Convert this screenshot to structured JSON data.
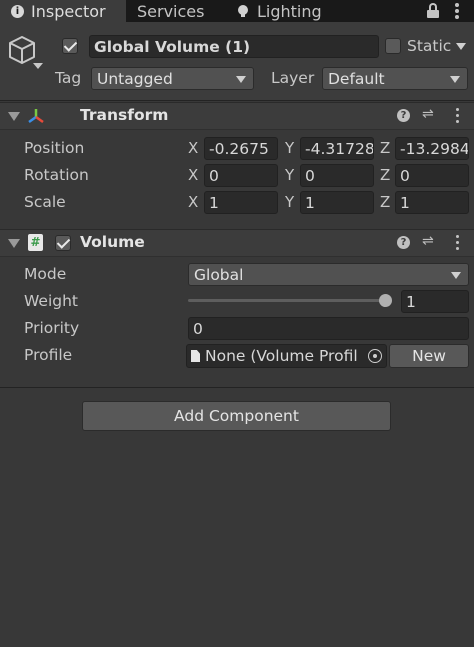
{
  "tabs": [
    {
      "label": "Inspector",
      "icon": "info-icon",
      "active": true
    },
    {
      "label": "Services",
      "active": false
    },
    {
      "label": "Lighting",
      "icon": "bulb-icon",
      "active": false
    }
  ],
  "gameobject": {
    "active": true,
    "name": "Global Volume (1)",
    "static_label": "Static",
    "static_checked": false,
    "tag_label": "Tag",
    "tag_value": "Untagged",
    "layer_label": "Layer",
    "layer_value": "Default"
  },
  "transform": {
    "title": "Transform",
    "rows": [
      {
        "label": "Position",
        "x": "-0.2675",
        "y": "-4.31728",
        "z": "-13.2984"
      },
      {
        "label": "Rotation",
        "x": "0",
        "y": "0",
        "z": "0"
      },
      {
        "label": "Scale",
        "x": "1",
        "y": "1",
        "z": "1"
      }
    ],
    "axes": [
      "X",
      "Y",
      "Z"
    ]
  },
  "volume": {
    "title": "Volume",
    "enabled": true,
    "mode_label": "Mode",
    "mode_value": "Global",
    "weight_label": "Weight",
    "weight_value": "1",
    "weight_fraction": 1.0,
    "priority_label": "Priority",
    "priority_value": "0",
    "profile_label": "Profile",
    "profile_value": "None (Volume Profil",
    "new_label": "New"
  },
  "add_component_label": "Add Component",
  "colors": {
    "background": "#383838",
    "tabbar": "#191919",
    "field": "#2a2a2a",
    "accent_slider": "#9a9a9a"
  }
}
